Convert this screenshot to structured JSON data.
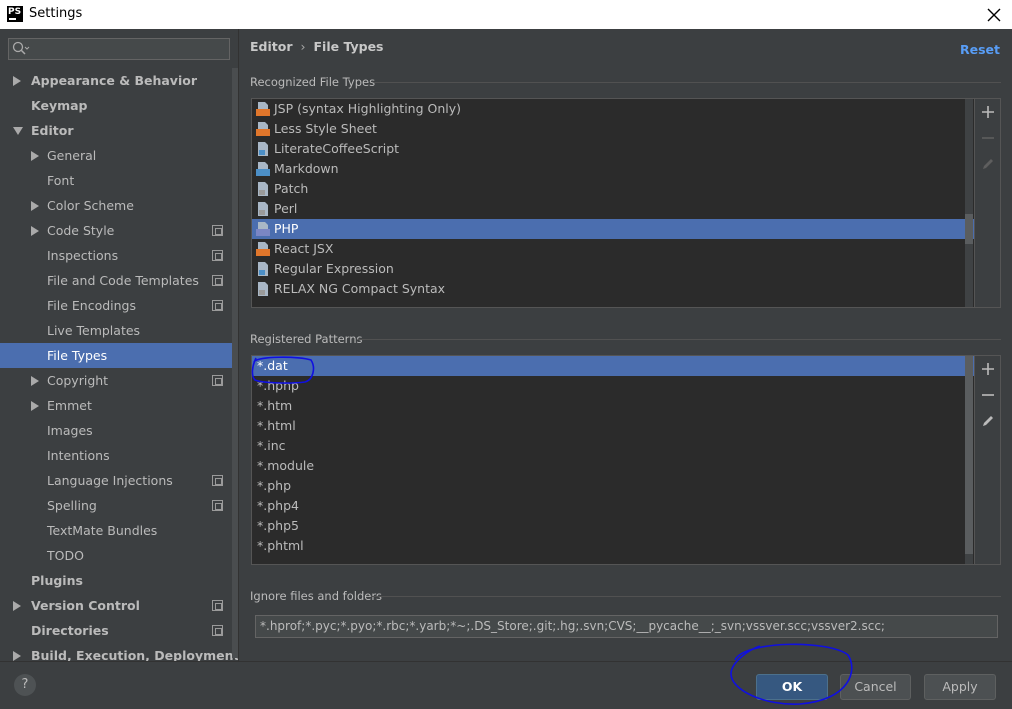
{
  "window": {
    "app_icon_text": "PS",
    "title": "Settings"
  },
  "sidebar": {
    "search": {
      "placeholder": ""
    },
    "items": [
      {
        "label": "Appearance & Behavior",
        "level": 0,
        "arrow": "right",
        "project": false,
        "selected": false
      },
      {
        "label": "Keymap",
        "level": 0,
        "arrow": "",
        "project": false,
        "selected": false
      },
      {
        "label": "Editor",
        "level": 0,
        "arrow": "down",
        "project": false,
        "selected": false
      },
      {
        "label": "General",
        "level": 1,
        "arrow": "right",
        "project": false,
        "selected": false
      },
      {
        "label": "Font",
        "level": 1,
        "arrow": "",
        "project": false,
        "selected": false
      },
      {
        "label": "Color Scheme",
        "level": 1,
        "arrow": "right",
        "project": false,
        "selected": false
      },
      {
        "label": "Code Style",
        "level": 1,
        "arrow": "right",
        "project": true,
        "selected": false
      },
      {
        "label": "Inspections",
        "level": 1,
        "arrow": "",
        "project": true,
        "selected": false
      },
      {
        "label": "File and Code Templates",
        "level": 1,
        "arrow": "",
        "project": true,
        "selected": false
      },
      {
        "label": "File Encodings",
        "level": 1,
        "arrow": "",
        "project": true,
        "selected": false
      },
      {
        "label": "Live Templates",
        "level": 1,
        "arrow": "",
        "project": false,
        "selected": false
      },
      {
        "label": "File Types",
        "level": 1,
        "arrow": "",
        "project": false,
        "selected": true
      },
      {
        "label": "Copyright",
        "level": 1,
        "arrow": "right",
        "project": true,
        "selected": false
      },
      {
        "label": "Emmet",
        "level": 1,
        "arrow": "right",
        "project": false,
        "selected": false
      },
      {
        "label": "Images",
        "level": 1,
        "arrow": "",
        "project": false,
        "selected": false
      },
      {
        "label": "Intentions",
        "level": 1,
        "arrow": "",
        "project": false,
        "selected": false
      },
      {
        "label": "Language Injections",
        "level": 1,
        "arrow": "",
        "project": true,
        "selected": false
      },
      {
        "label": "Spelling",
        "level": 1,
        "arrow": "",
        "project": true,
        "selected": false
      },
      {
        "label": "TextMate Bundles",
        "level": 1,
        "arrow": "",
        "project": false,
        "selected": false
      },
      {
        "label": "TODO",
        "level": 1,
        "arrow": "",
        "project": false,
        "selected": false
      },
      {
        "label": "Plugins",
        "level": 0,
        "arrow": "",
        "project": false,
        "selected": false
      },
      {
        "label": "Version Control",
        "level": 0,
        "arrow": "right",
        "project": true,
        "selected": false
      },
      {
        "label": "Directories",
        "level": 0,
        "arrow": "",
        "project": true,
        "selected": false
      },
      {
        "label": "Build, Execution, Deployment",
        "level": 0,
        "arrow": "right",
        "project": false,
        "selected": false
      }
    ]
  },
  "breadcrumb": {
    "parent": "Editor",
    "separator": "›",
    "current": "File Types"
  },
  "reset_label": "Reset",
  "recognized": {
    "title": "Recognized File Types",
    "items": [
      {
        "label": "JSP (syntax Highlighting Only)",
        "icon": "jsp-file-icon",
        "badge": "JSP",
        "color": "#e0762b",
        "selected": false
      },
      {
        "label": "Less Style Sheet",
        "icon": "less-file-icon",
        "badge": "LESS",
        "color": "#e0762b",
        "selected": false
      },
      {
        "label": "LiterateCoffeeScript",
        "icon": "coffeescript-file-icon",
        "badge": "",
        "color": "#4c8fc7",
        "selected": false
      },
      {
        "label": "Markdown",
        "icon": "markdown-file-icon",
        "badge": "MD",
        "color": "#4c8fc7",
        "selected": false
      },
      {
        "label": "Patch",
        "icon": "patch-file-icon",
        "badge": "",
        "color": "#9a9a9a",
        "selected": false
      },
      {
        "label": "Perl",
        "icon": "perl-file-icon",
        "badge": "",
        "color": "#9a9a9a",
        "selected": false
      },
      {
        "label": "PHP",
        "icon": "php-file-icon",
        "badge": "PHP",
        "color": "#7b86c4",
        "selected": true
      },
      {
        "label": "React JSX",
        "icon": "jsx-file-icon",
        "badge": "JSX",
        "color": "#e0762b",
        "selected": false
      },
      {
        "label": "Regular Expression",
        "icon": "regex-file-icon",
        "badge": "",
        "color": "#4c8fc7",
        "selected": false
      },
      {
        "label": "RELAX NG Compact Syntax",
        "icon": "relaxng-file-icon",
        "badge": "",
        "color": "#9a9a9a",
        "selected": false
      }
    ]
  },
  "patterns": {
    "title": "Registered Patterns",
    "items": [
      "*.dat",
      "*.hphp",
      "*.htm",
      "*.html",
      "*.inc",
      "*.module",
      "*.php",
      "*.php4",
      "*.php5",
      "*.phtml"
    ]
  },
  "ignore": {
    "title": "Ignore files and folders",
    "value": "*.hprof;*.pyc;*.pyo;*.rbc;*.yarb;*~;.DS_Store;.git;.hg;.svn;CVS;__pycache__;_svn;vssver.scc;vssver2.scc;"
  },
  "buttons": {
    "ok": "OK",
    "cancel": "Cancel",
    "apply": "Apply",
    "help": "?"
  },
  "colors": {
    "accent": "#4b6eaf",
    "link": "#589df6",
    "annotation": "#1010e0"
  }
}
